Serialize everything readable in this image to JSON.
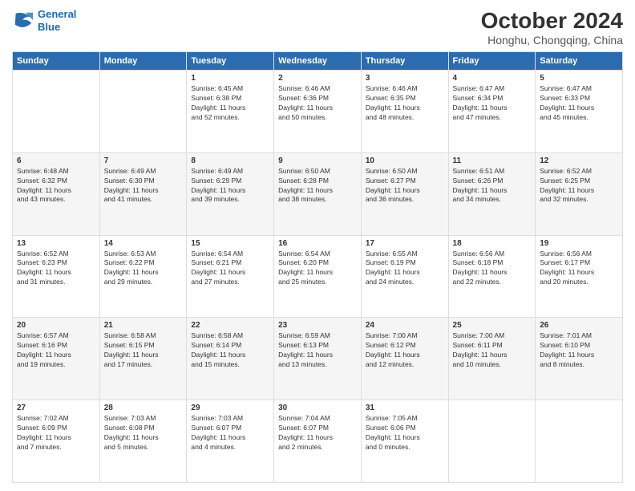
{
  "header": {
    "logo": {
      "line1": "General",
      "line2": "Blue"
    },
    "title": "October 2024",
    "subtitle": "Honghu, Chongqing, China"
  },
  "days_of_week": [
    "Sunday",
    "Monday",
    "Tuesday",
    "Wednesday",
    "Thursday",
    "Friday",
    "Saturday"
  ],
  "weeks": [
    [
      {
        "day": "",
        "info": ""
      },
      {
        "day": "",
        "info": ""
      },
      {
        "day": "1",
        "info": "Sunrise: 6:45 AM\nSunset: 6:38 PM\nDaylight: 11 hours\nand 52 minutes."
      },
      {
        "day": "2",
        "info": "Sunrise: 6:46 AM\nSunset: 6:36 PM\nDaylight: 11 hours\nand 50 minutes."
      },
      {
        "day": "3",
        "info": "Sunrise: 6:46 AM\nSunset: 6:35 PM\nDaylight: 11 hours\nand 48 minutes."
      },
      {
        "day": "4",
        "info": "Sunrise: 6:47 AM\nSunset: 6:34 PM\nDaylight: 11 hours\nand 47 minutes."
      },
      {
        "day": "5",
        "info": "Sunrise: 6:47 AM\nSunset: 6:33 PM\nDaylight: 11 hours\nand 45 minutes."
      }
    ],
    [
      {
        "day": "6",
        "info": "Sunrise: 6:48 AM\nSunset: 6:32 PM\nDaylight: 11 hours\nand 43 minutes."
      },
      {
        "day": "7",
        "info": "Sunrise: 6:49 AM\nSunset: 6:30 PM\nDaylight: 11 hours\nand 41 minutes."
      },
      {
        "day": "8",
        "info": "Sunrise: 6:49 AM\nSunset: 6:29 PM\nDaylight: 11 hours\nand 39 minutes."
      },
      {
        "day": "9",
        "info": "Sunrise: 6:50 AM\nSunset: 6:28 PM\nDaylight: 11 hours\nand 38 minutes."
      },
      {
        "day": "10",
        "info": "Sunrise: 6:50 AM\nSunset: 6:27 PM\nDaylight: 11 hours\nand 36 minutes."
      },
      {
        "day": "11",
        "info": "Sunrise: 6:51 AM\nSunset: 6:26 PM\nDaylight: 11 hours\nand 34 minutes."
      },
      {
        "day": "12",
        "info": "Sunrise: 6:52 AM\nSunset: 6:25 PM\nDaylight: 11 hours\nand 32 minutes."
      }
    ],
    [
      {
        "day": "13",
        "info": "Sunrise: 6:52 AM\nSunset: 6:23 PM\nDaylight: 11 hours\nand 31 minutes."
      },
      {
        "day": "14",
        "info": "Sunrise: 6:53 AM\nSunset: 6:22 PM\nDaylight: 11 hours\nand 29 minutes."
      },
      {
        "day": "15",
        "info": "Sunrise: 6:54 AM\nSunset: 6:21 PM\nDaylight: 11 hours\nand 27 minutes."
      },
      {
        "day": "16",
        "info": "Sunrise: 6:54 AM\nSunset: 6:20 PM\nDaylight: 11 hours\nand 25 minutes."
      },
      {
        "day": "17",
        "info": "Sunrise: 6:55 AM\nSunset: 6:19 PM\nDaylight: 11 hours\nand 24 minutes."
      },
      {
        "day": "18",
        "info": "Sunrise: 6:56 AM\nSunset: 6:18 PM\nDaylight: 11 hours\nand 22 minutes."
      },
      {
        "day": "19",
        "info": "Sunrise: 6:56 AM\nSunset: 6:17 PM\nDaylight: 11 hours\nand 20 minutes."
      }
    ],
    [
      {
        "day": "20",
        "info": "Sunrise: 6:57 AM\nSunset: 6:16 PM\nDaylight: 11 hours\nand 19 minutes."
      },
      {
        "day": "21",
        "info": "Sunrise: 6:58 AM\nSunset: 6:15 PM\nDaylight: 11 hours\nand 17 minutes."
      },
      {
        "day": "22",
        "info": "Sunrise: 6:58 AM\nSunset: 6:14 PM\nDaylight: 11 hours\nand 15 minutes."
      },
      {
        "day": "23",
        "info": "Sunrise: 6:59 AM\nSunset: 6:13 PM\nDaylight: 11 hours\nand 13 minutes."
      },
      {
        "day": "24",
        "info": "Sunrise: 7:00 AM\nSunset: 6:12 PM\nDaylight: 11 hours\nand 12 minutes."
      },
      {
        "day": "25",
        "info": "Sunrise: 7:00 AM\nSunset: 6:11 PM\nDaylight: 11 hours\nand 10 minutes."
      },
      {
        "day": "26",
        "info": "Sunrise: 7:01 AM\nSunset: 6:10 PM\nDaylight: 11 hours\nand 8 minutes."
      }
    ],
    [
      {
        "day": "27",
        "info": "Sunrise: 7:02 AM\nSunset: 6:09 PM\nDaylight: 11 hours\nand 7 minutes."
      },
      {
        "day": "28",
        "info": "Sunrise: 7:03 AM\nSunset: 6:08 PM\nDaylight: 11 hours\nand 5 minutes."
      },
      {
        "day": "29",
        "info": "Sunrise: 7:03 AM\nSunset: 6:07 PM\nDaylight: 11 hours\nand 4 minutes."
      },
      {
        "day": "30",
        "info": "Sunrise: 7:04 AM\nSunset: 6:07 PM\nDaylight: 11 hours\nand 2 minutes."
      },
      {
        "day": "31",
        "info": "Sunrise: 7:05 AM\nSunset: 6:06 PM\nDaylight: 11 hours\nand 0 minutes."
      },
      {
        "day": "",
        "info": ""
      },
      {
        "day": "",
        "info": ""
      }
    ]
  ]
}
